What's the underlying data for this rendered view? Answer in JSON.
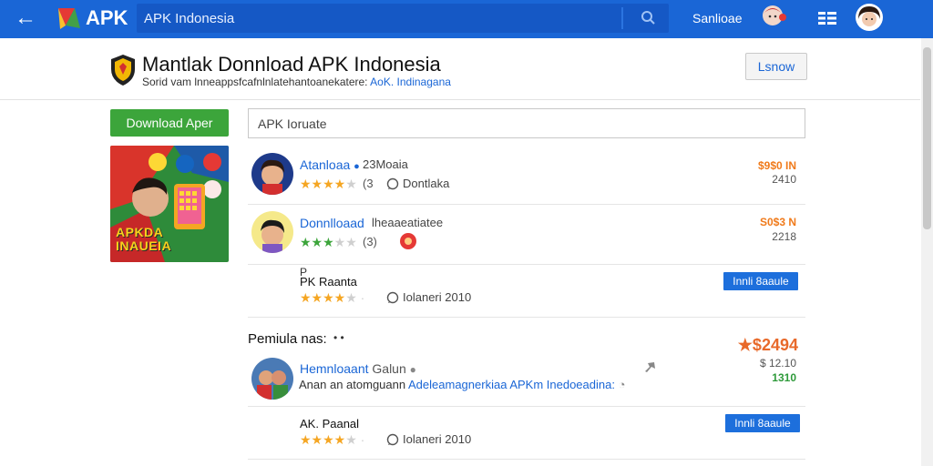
{
  "topbar": {
    "brand": "APK",
    "search_value": "APK Indonesia",
    "right_link": "Sanlioae",
    "colors": {
      "bar": "#1a66d6"
    }
  },
  "header": {
    "title": "Mantlak Donnload APK Indonesia",
    "subtitle_plain": "Sorid vam lnneappsfcafnlnlatehantoanekatere:",
    "subtitle_accent": "AoK. Indinagana",
    "login_label": "Lsnow"
  },
  "sidebar": {
    "download_label": "Download Aper",
    "promo_text_line1": "APKDA",
    "promo_text_line2": "INAUEIA"
  },
  "filter": {
    "value": "APK Ioruate"
  },
  "apps": [
    {
      "name": "Atanloaa",
      "meta": "23Moaia",
      "rating_count": "(3",
      "comment": "Dontlaka",
      "price": "$9$0 IN",
      "price_sub": "2410",
      "rating": 4
    },
    {
      "name": "Donnlloaad",
      "meta": "lheaaeatiatee",
      "rating_count": "(3)",
      "price": "S0$3 N",
      "price_sub": "2218",
      "rating": 3
    }
  ],
  "sub_items": [
    {
      "label": "P",
      "title": "PK Raanta",
      "comment": "Iolaneri 2010",
      "install_label": "Innli 8aaule",
      "rating": 4
    }
  ],
  "section": {
    "title": "Pemiula nas:",
    "dots": "• •"
  },
  "featured": {
    "name": "Hemnloaant",
    "name_suffix": "Galun",
    "desc_plain": "Anan an atomguann",
    "desc_link": "Adeleamagnerkiaa APKm Inedoeadina:",
    "big_price": "★$2494",
    "price_sub": "$ 12.10",
    "green_price": "1310"
  },
  "sub_items2": [
    {
      "title": "AK. Paanal",
      "comment": "Iolaneri 2010",
      "install_label": "Innli 8aaule",
      "rating": 4
    }
  ]
}
